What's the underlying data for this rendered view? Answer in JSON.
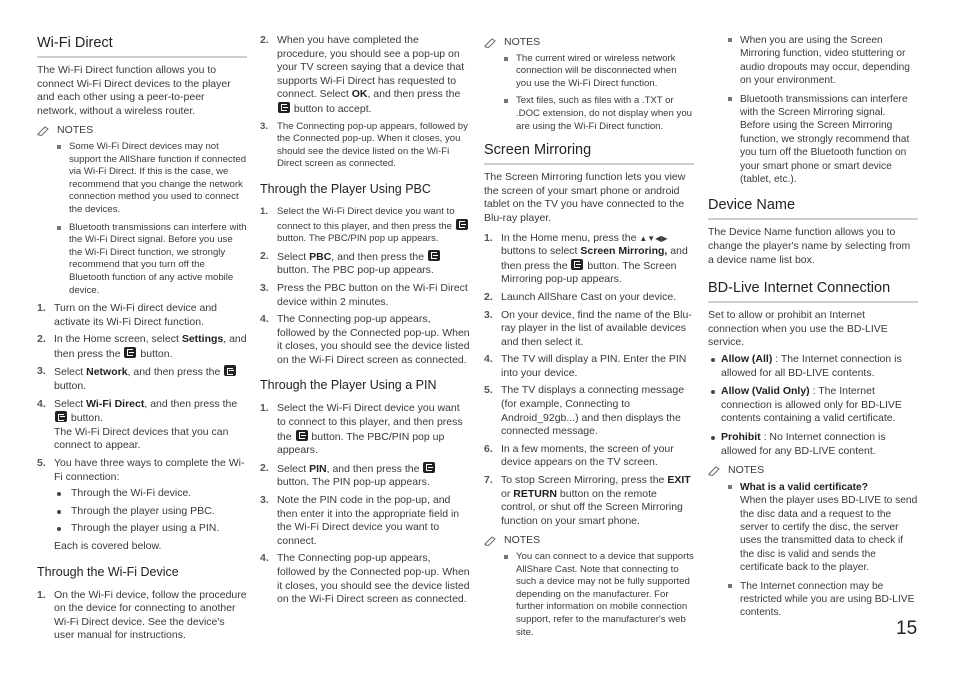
{
  "page_number": "15",
  "notes_label": "NOTES",
  "wifi_direct": {
    "title": "Wi-Fi Direct",
    "intro": "The Wi-Fi Direct function allows you to connect Wi-Fi Direct devices to the player and each other using a peer-to-peer network, without a wireless router.",
    "notes": [
      "Some Wi-Fi Direct devices may not support the AllShare function if connected via Wi-Fi Direct. If this is the case, we recommend that you change the network connection method you used to connect the devices.",
      "Bluetooth transmissions can interfere with the Wi-Fi Direct signal. Before you use the Wi-Fi Direct function, we strongly recommend that you turn off the Bluetooth function of any active mobile device."
    ],
    "steps": {
      "s1": "Turn on the Wi-Fi direct device and activate its Wi-Fi Direct function.",
      "s2_a": "In the Home screen, select ",
      "s2_b": "Settings",
      "s2_c": ", and then press the ",
      "s2_d": " button.",
      "s3_a": "Select ",
      "s3_b": "Network",
      "s3_c": ", and then press the ",
      "s3_d": " button.",
      "s4_a": "Select ",
      "s4_b": "Wi-Fi Direct",
      "s4_c": ", and then press the ",
      "s4_d": " button.",
      "s4_e": "The Wi-Fi Direct devices that you can connect to appear.",
      "s5": "You have three ways to complete the Wi-Fi connection:",
      "s5_options": [
        "Through the Wi-Fi device.",
        "Through the player using PBC.",
        "Through the player using a PIN."
      ],
      "s5_after": "Each is covered below."
    },
    "through_device": {
      "title": "Through the Wi-Fi Device",
      "s1": "On the Wi-Fi device, follow the procedure on the device for connecting to another Wi-Fi Direct device. See the device's user manual for instructions.",
      "s2_a": "When you have completed the procedure, you should see a pop-up on your TV screen saying that a device that supports Wi-Fi Direct has requested to connect. Select ",
      "s2_b": "OK",
      "s2_c": ", and then press the ",
      "s2_d": " button to accept.",
      "s3": "The Connecting pop-up appears, followed by the Connected pop-up. When it closes, you should see the device listed on the Wi-Fi Direct screen as connected."
    },
    "through_pbc": {
      "title": "Through the Player Using PBC",
      "s1_a": "Select the Wi-Fi Direct device you want to connect to this player, and then press the ",
      "s1_b": " button. The PBC/PIN pop up appears.",
      "s2_a": "Select ",
      "s2_b": "PBC",
      "s2_c": ", and then press the ",
      "s2_d": " button. The PBC pop-up appears.",
      "s3": "Press the PBC button on the Wi-Fi Direct device within 2 minutes.",
      "s4": "The Connecting pop-up appears, followed by the Connected pop-up. When it closes, you should see the device listed on the Wi-Fi Direct screen as connected."
    },
    "through_pin": {
      "title": "Through the Player Using a PIN",
      "s1_a": "Select the Wi-Fi Direct device you want to connect to this player, and then press the ",
      "s1_b": " button. The PBC/PIN pop up appears.",
      "s2_a": "Select ",
      "s2_b": "PIN",
      "s2_c": ", and then press the ",
      "s2_d": " button. The PIN pop-up appears.",
      "s3": "Note the PIN code in the pop-up, and then enter it into the appropriate field in the Wi-Fi Direct device you want to connect.",
      "s4": "The Connecting pop-up appears, followed by the Connected pop-up. When it closes, you should see the device listed on the Wi-Fi Direct screen as connected."
    },
    "notes_end": [
      "The current wired or wireless network connection will be disconnected when you use the Wi-Fi Direct function.",
      "Text files, such as files with a .TXT or .DOC extension, do not display when you are using the Wi-Fi Direct function."
    ]
  },
  "screen_mirroring": {
    "title": "Screen Mirroring",
    "intro": "The Screen Mirroring function lets you view the screen of your smart phone or android tablet on the TV you have connected to the Blu-ray player.",
    "s1_a": "In the Home menu, press the ",
    "s1_arrows": "▲▼◀▶",
    "s1_b": " buttons to select ",
    "s1_c": "Screen Mirroring,",
    "s1_d": " and then press the ",
    "s1_e": " button. The Screen Mirroring pop-up appears.",
    "s2": "Launch AllShare Cast on your device.",
    "s3": "On your device, find the name of the Blu-ray player in the list of available devices and then select it.",
    "s4": "The TV will display a PIN. Enter the PIN into your device.",
    "s5": "The TV displays a connecting message (for example, Connecting to Android_92gb...) and then displays the connected message.",
    "s6": "In a few moments, the screen of your device appears on the TV screen.",
    "s7_a": "To stop Screen Mirroring, press the ",
    "s7_b": "EXIT",
    "s7_c": " or ",
    "s7_d": "RETURN",
    "s7_e": " button on the remote control, or shut off the Screen Mirroring function on your smart phone.",
    "notes": [
      "You can connect to a device that supports AllShare Cast. Note that connecting to such a device may not be fully supported depending on the manufacturer. For further information on mobile connection support, refer to the manufacturer's web site.",
      "When you are using the Screen Mirroring function, video stuttering or audio dropouts may occur, depending on your environment.",
      "Bluetooth transmissions can interfere with the Screen Mirroring signal. Before using the Screen Mirroring function, we strongly recommend that you turn off the Bluetooth function on your smart phone or smart device (tablet, etc.)."
    ]
  },
  "device_name": {
    "title": "Device Name",
    "body": "The Device Name function allows you to change the player's name by selecting from a device name list box."
  },
  "bd_live": {
    "title": "BD-Live Internet Connection",
    "intro": "Set to allow or prohibit an Internet connection when you use the BD-LIVE service.",
    "options": [
      {
        "label": "Allow (All)",
        "desc": " : The Internet connection is allowed for all BD-LIVE contents."
      },
      {
        "label": "Allow (Valid Only)",
        "desc": " : The Internet connection is allowed only for BD-LIVE contents containing a valid certificate."
      },
      {
        "label": "Prohibit",
        "desc": " : No Internet connection is allowed for any BD-LIVE content."
      }
    ],
    "note1_title": "What is a valid certificate?",
    "note1_body": "When the player uses BD-LIVE to send the disc data and a request to the server to certify the disc, the server uses the transmitted data to check if the disc is valid and sends the certificate back to the player.",
    "note2": "The Internet connection may be restricted while you are using BD-LIVE contents."
  }
}
